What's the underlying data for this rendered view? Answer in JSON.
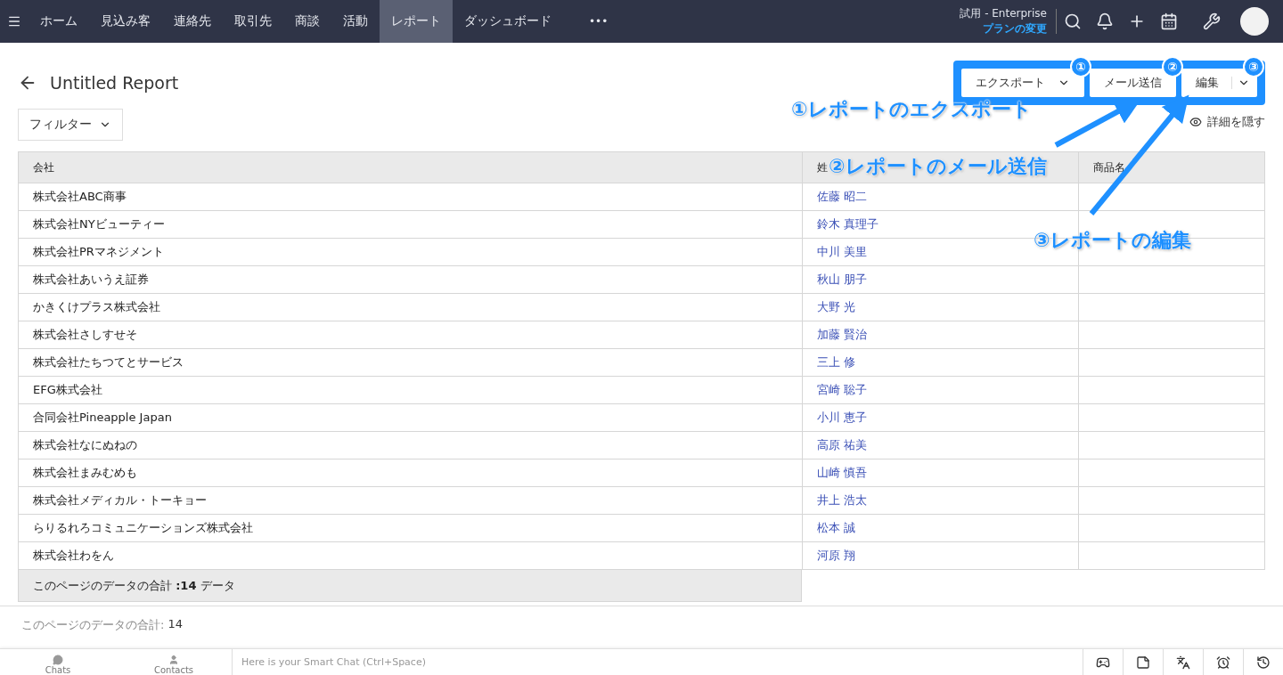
{
  "nav": {
    "items": [
      {
        "label": "ホーム",
        "selected": false
      },
      {
        "label": "見込み客",
        "selected": false
      },
      {
        "label": "連絡先",
        "selected": false
      },
      {
        "label": "取引先",
        "selected": false
      },
      {
        "label": "商談",
        "selected": false
      },
      {
        "label": "活動",
        "selected": false
      },
      {
        "label": "レポート",
        "selected": true
      },
      {
        "label": "ダッシュボード",
        "selected": false
      }
    ],
    "more": "•••",
    "plan": "試用 - Enterprise",
    "plan_link": "プランの変更"
  },
  "report": {
    "title": "Untitled Report",
    "filter": "フィルター",
    "hide_details": "詳細を隠す",
    "buttons": [
      {
        "label": "エクスポート",
        "badge": "①",
        "kind": "dropdown"
      },
      {
        "label": "メール送信",
        "badge": "②",
        "kind": "plain"
      },
      {
        "label": "編集",
        "badge": "③",
        "kind": "split"
      }
    ]
  },
  "callouts": [
    "①レポートのエクスポート",
    "②レポートのメール送信",
    "③レポートの編集"
  ],
  "table": {
    "columns": [
      "会社",
      "姓",
      "商品名"
    ],
    "rows": [
      [
        "株式会社ABC商事",
        "佐藤 昭二"
      ],
      [
        "株式会社NYビューティー",
        "鈴木 真理子"
      ],
      [
        "株式会社PRマネジメント",
        "中川 美里"
      ],
      [
        "株式会社あいうえ証券",
        "秋山 朋子"
      ],
      [
        "かきくけプラス株式会社",
        "大野 光"
      ],
      [
        "株式会社さしすせそ",
        "加藤 賢治"
      ],
      [
        "株式会社たちつてとサービス",
        "三上 修"
      ],
      [
        "EFG株式会社",
        "宮崎 聡子"
      ],
      [
        "合同会社Pineapple Japan",
        "小川 恵子"
      ],
      [
        "株式会社なにぬねの",
        "高原 祐美"
      ],
      [
        "株式会社まみむめも",
        "山崎 慎吾"
      ],
      [
        "株式会社メディカル・トーキョー",
        "井上 浩太"
      ],
      [
        "らりるれろコミュニケーションズ株式会社",
        "松本 誠"
      ],
      [
        "株式会社わをん",
        "河原 翔"
      ]
    ],
    "total": "このページのデータの合計 **:14** データ"
  },
  "summary": {
    "label": "このページのデータの合計:",
    "value": "14"
  },
  "bottom_bar": {
    "tabs": [
      "Chats",
      "Contacts"
    ],
    "chat_placeholder": "Here is your Smart Chat (Ctrl+Space)"
  }
}
